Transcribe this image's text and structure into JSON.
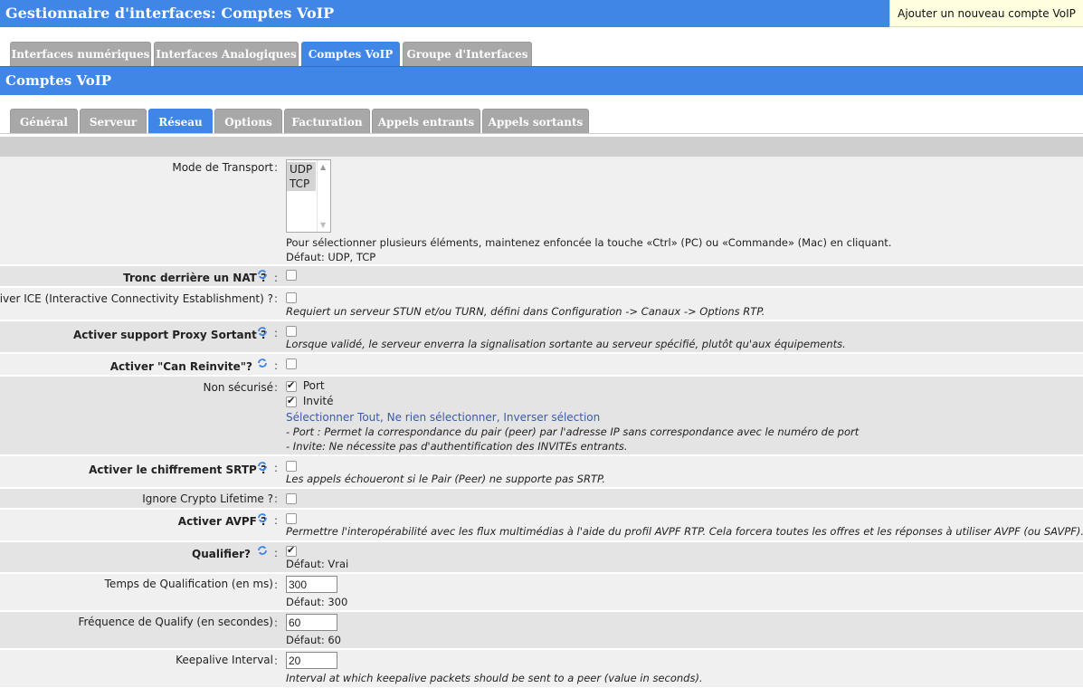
{
  "header": {
    "title": "Gestionnaire d'interfaces:  Comptes VoIP",
    "add_button": "Ajouter un nouveau compte VoIP"
  },
  "main_tabs": [
    {
      "label": "Interfaces numériques",
      "active": false
    },
    {
      "label": "Interfaces Analogiques",
      "active": false
    },
    {
      "label": "Comptes VoIP",
      "active": true
    },
    {
      "label": "Groupe d'Interfaces",
      "active": false
    }
  ],
  "section": {
    "title": "Comptes VoIP"
  },
  "sub_tabs": [
    {
      "label": "Général",
      "active": false
    },
    {
      "label": "Serveur",
      "active": false
    },
    {
      "label": "Réseau",
      "active": true
    },
    {
      "label": "Options",
      "active": false
    },
    {
      "label": "Facturation",
      "active": false
    },
    {
      "label": "Appels entrants",
      "active": false
    },
    {
      "label": "Appels sortants",
      "active": false
    }
  ],
  "form": {
    "transport": {
      "label": "Mode de Transport",
      "options": [
        "UDP",
        "TCP"
      ],
      "help": "Pour sélectionner plusieurs éléments, maintenez enfoncée la touche «Ctrl» (PC) ou «Commande» (Mac) en cliquant.",
      "default": "Défaut: UDP, TCP"
    },
    "nat": {
      "label": "Tronc derrière un NAT ?",
      "checked": false
    },
    "ice": {
      "label": "Activer ICE (Interactive Connectivity Establishment) ?",
      "checked": false,
      "help": "Requiert un serveur STUN et/ou TURN, défini dans Configuration -> Canaux -> Options RTP."
    },
    "proxy": {
      "label": "Activer support Proxy Sortant ?",
      "checked": false,
      "help": "Lorsque validé, le serveur enverra la signalisation sortante au serveur spécifié, plutôt qu'aux équipements."
    },
    "reinvite": {
      "label": "Activer \"Can Reinvite\"?",
      "checked": false
    },
    "insecure": {
      "label": "Non sécurisé",
      "port_label": "Port",
      "port_checked": true,
      "invite_label": "Invité",
      "invite_checked": true,
      "select_all": "Sélectionner Tout",
      "select_none": "Ne rien sélectionner",
      "invert": "Inverser sélection",
      "sep1": ", ",
      "sep2": ", ",
      "help_port": "- Port : Permet la correspondance du pair (peer) par l'adresse IP sans correspondance avec le numéro de port",
      "help_invite": "- Invite: Ne nécessite pas d'authentification des INVITEs entrants."
    },
    "srtp": {
      "label": "Activer le chiffrement SRTP ?",
      "checked": false,
      "help": "Les appels échoueront si le Pair (Peer) ne supporte pas SRTP."
    },
    "crypto": {
      "label": "Ignore Crypto Lifetime ?",
      "checked": false
    },
    "avpf": {
      "label": "Activer AVPF ?",
      "checked": false,
      "help": "Permettre l'interopérabilité avec les flux multimédias à l'aide du profil AVPF RTP. Cela forcera toutes les offres et les réponses à utiliser AVPF (ou SAVPF)."
    },
    "qualify": {
      "label": "Qualifier?",
      "checked": true,
      "default": "Défaut: Vrai"
    },
    "qualify_time": {
      "label": "Temps de Qualification (en ms)",
      "value": "300",
      "default": "Défaut: 300"
    },
    "qualify_freq": {
      "label": "Fréquence de Qualify (en secondes)",
      "value": "60",
      "default": "Défaut: 60"
    },
    "keepalive": {
      "label": "Keepalive Interval",
      "value": "20",
      "help": "Interval at which keepalive packets should be sent to a peer (value in seconds)."
    },
    "colon": ":"
  },
  "colors": {
    "accent": "#3f86e6",
    "tab_inactive": "#a8a8a8",
    "add_button_bg": "#ffffe0"
  }
}
